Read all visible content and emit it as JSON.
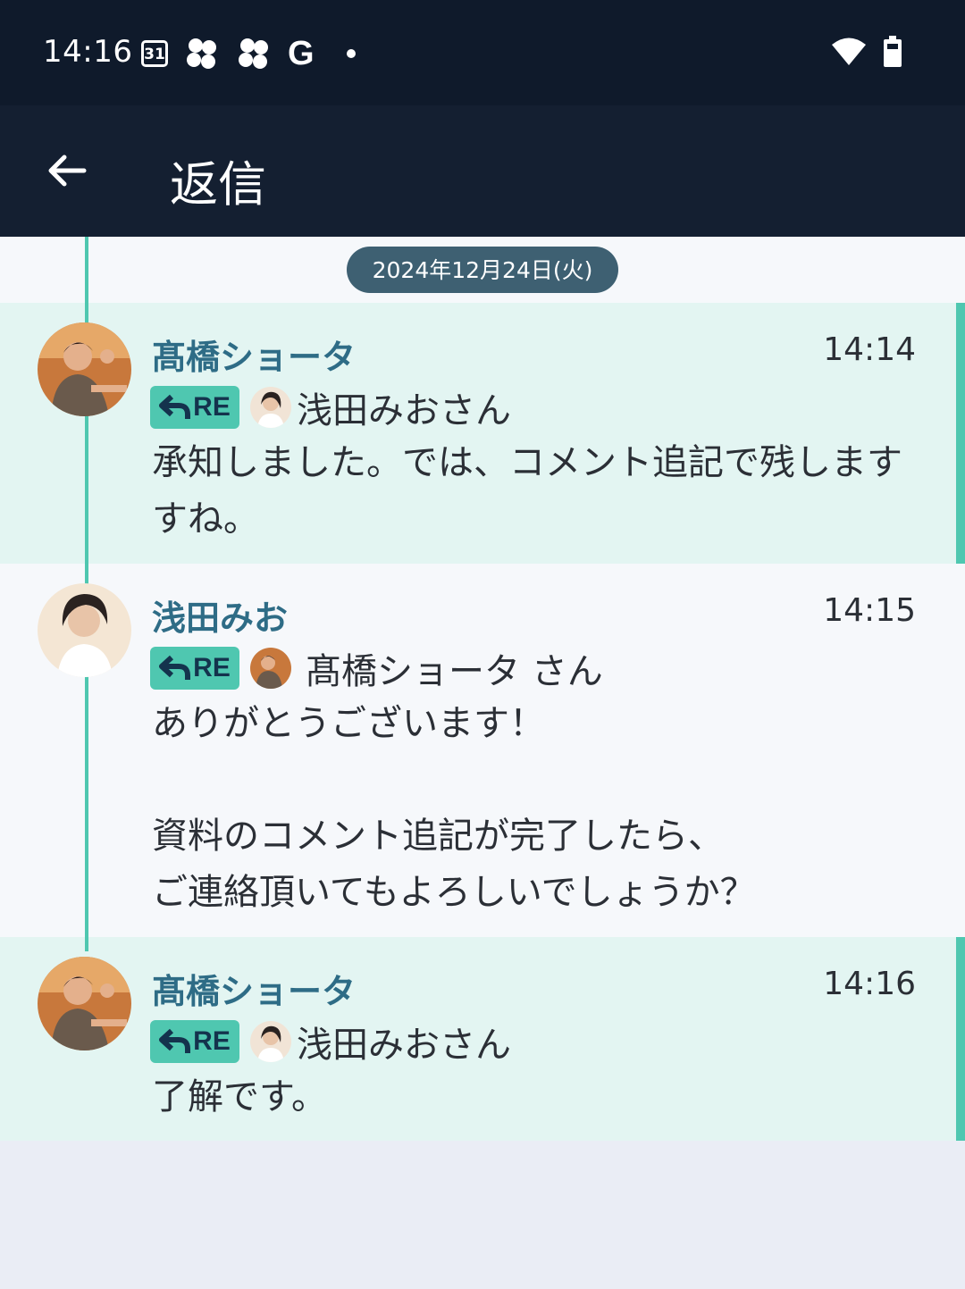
{
  "status_bar": {
    "time": "14:16",
    "calendar_day": "31",
    "google_letter": "G",
    "icons": [
      "calendar-icon",
      "flower-icon",
      "flower-icon",
      "google-icon",
      "notification-dot",
      "wifi-icon",
      "battery-icon"
    ]
  },
  "app_bar": {
    "title": "返信"
  },
  "date_separator": "2024年12月24日(火)",
  "messages": [
    {
      "sender": "髙橋ショータ",
      "time": "14:14",
      "re_label": "RE",
      "reply_to": "浅田みおさん",
      "body": "承知しました。では、コメント追記で残します\nすね。"
    },
    {
      "sender": "浅田みお",
      "time": "14:15",
      "re_label": "RE",
      "reply_to": "髙橋ショータ さん",
      "body": "ありがとうございます！\n\n資料のコメント追記が完了したら、\nご連絡頂いてもよろしいでしょうか？"
    },
    {
      "sender": "髙橋ショータ",
      "time": "14:16",
      "re_label": "RE",
      "reply_to": "浅田みおさん",
      "body": "了解です。"
    }
  ],
  "colors": {
    "status_bar": "#0f1a2b",
    "app_bar": "#141f31",
    "accent": "#4fc7b0",
    "sender_name": "#2e6c86",
    "mine_bg": "#e3f5f2",
    "date_pill": "#3e6072"
  }
}
